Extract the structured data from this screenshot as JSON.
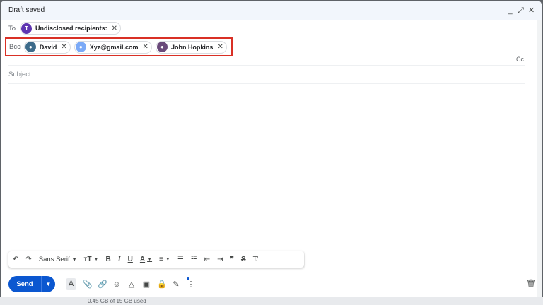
{
  "window": {
    "title": "Draft saved"
  },
  "titlebar_icons": [
    "minimize-icon",
    "expand-icon",
    "close-icon"
  ],
  "to": {
    "label": "To",
    "chips": [
      {
        "avatar_letter": "T",
        "avatar_color": "#5e35b1",
        "name": "Undisclosed recipients:"
      }
    ]
  },
  "bcc": {
    "label": "Bcc",
    "chips": [
      {
        "name": "David",
        "avatar_color": "#3d6b8a"
      },
      {
        "name": "Xyz@gmail.com",
        "avatar_color": "#7baaf7"
      },
      {
        "name": "John Hopkins",
        "avatar_color": "#6a4a7a"
      }
    ]
  },
  "cc_label": "Cc",
  "subject": {
    "placeholder": "Subject"
  },
  "formatting": {
    "undo": "↶",
    "redo": "↷",
    "font": "Sans Serif",
    "size": "тT",
    "bold": "B",
    "italic": "I",
    "underline": "U",
    "text_color": "A"
  },
  "send": {
    "label": "Send"
  },
  "storage": "0.45 GB of 15 GB used"
}
